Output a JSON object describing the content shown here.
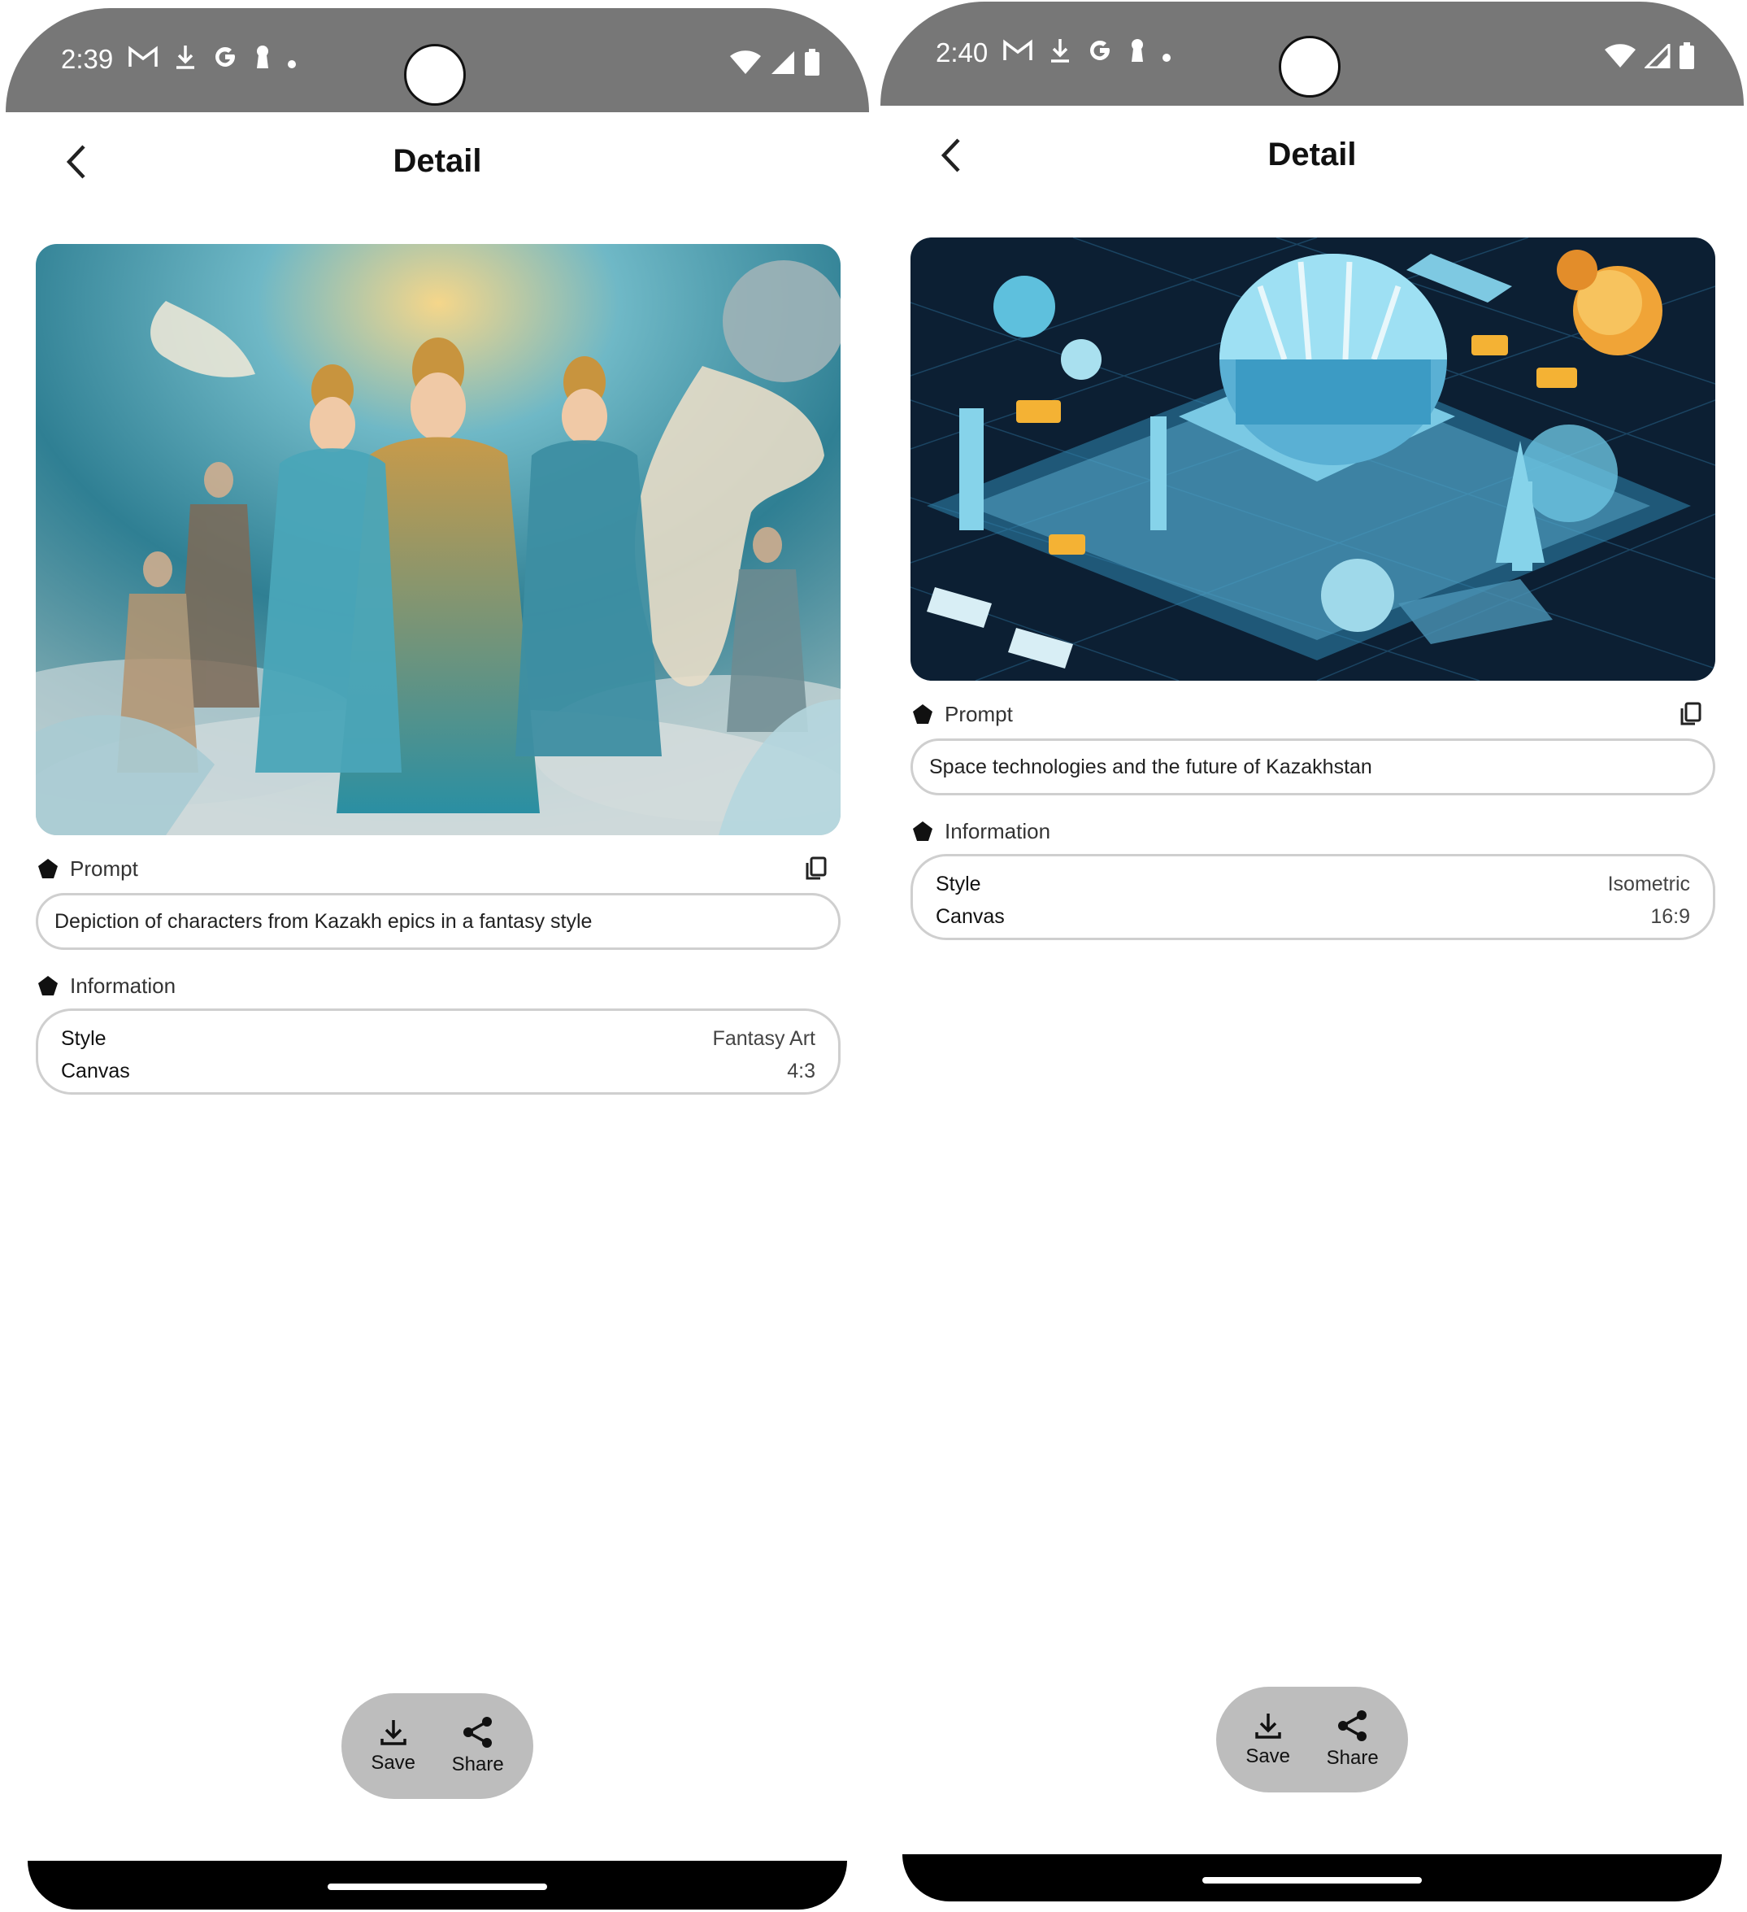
{
  "screens": [
    {
      "status": {
        "time": "2:39"
      },
      "appbar": {
        "title": "Detail"
      },
      "prompt": {
        "label": "Prompt",
        "text": "Depiction of characters from Kazakh epics in a fantasy style"
      },
      "information": {
        "label": "Information",
        "rows": [
          {
            "key": "Style",
            "value": "Fantasy Art"
          },
          {
            "key": "Canvas",
            "value": "4:3"
          }
        ]
      },
      "actions": {
        "save_label": "Save",
        "share_label": "Share"
      }
    },
    {
      "status": {
        "time": "2:40"
      },
      "appbar": {
        "title": "Detail"
      },
      "prompt": {
        "label": "Prompt",
        "text": "Space technologies and the future of Kazakhstan"
      },
      "information": {
        "label": "Information",
        "rows": [
          {
            "key": "Style",
            "value": "Isometric"
          },
          {
            "key": "Canvas",
            "value": "16:9"
          }
        ]
      },
      "actions": {
        "save_label": "Save",
        "share_label": "Share"
      }
    }
  ],
  "colors": {
    "status_bar": "#777777",
    "action_pill": "#bdbdbd",
    "field_border": "#cfcfcf",
    "nav_bar": "#000000"
  }
}
